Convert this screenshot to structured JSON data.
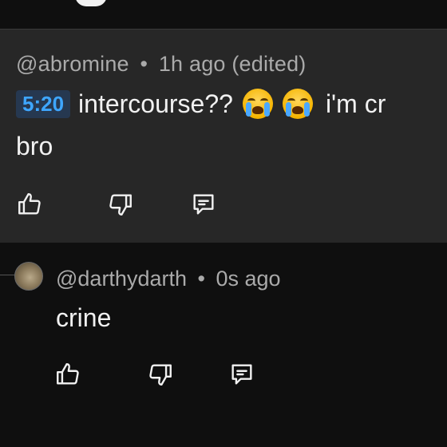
{
  "comment": {
    "author": "@abromine",
    "separator": "•",
    "time": "1h ago (edited)",
    "timestamp_link": "5:20",
    "text_part1": "intercourse??",
    "text_part2": "i'm cr",
    "text_line2": "bro",
    "emoji": "loudly-crying-face"
  },
  "reply": {
    "author": "@darthydarth",
    "separator": "•",
    "time": "0s ago",
    "text": "crine"
  },
  "icons": {
    "like": "thumbs-up-icon",
    "dislike": "thumbs-down-icon",
    "reply": "reply-icon"
  },
  "colors": {
    "background": "#0f0f0f",
    "card": "#272727",
    "timestamp_link": "#3ea6ff",
    "meta_text": "#aaaaaa"
  }
}
